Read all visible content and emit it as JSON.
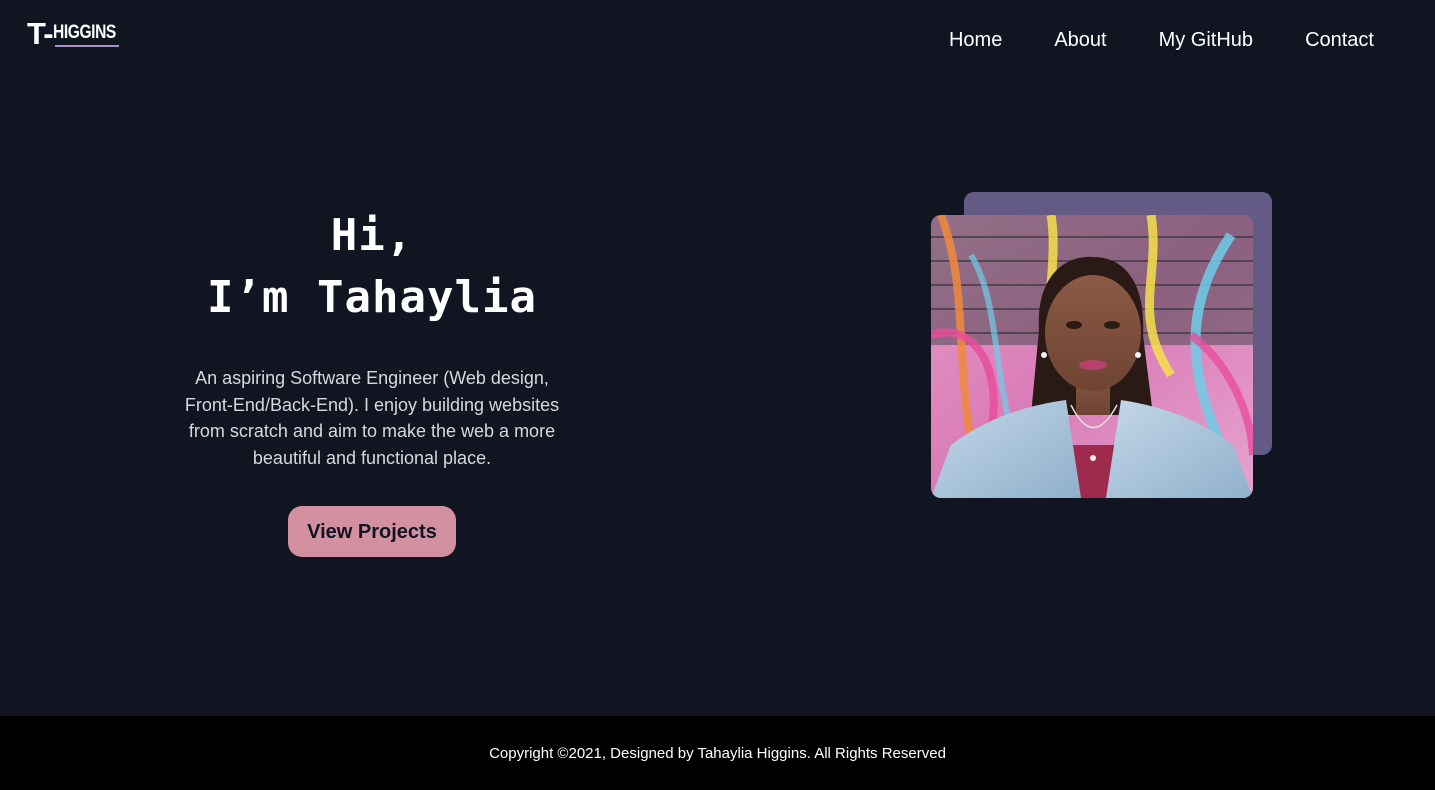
{
  "logo": {
    "t": "T-",
    "name": "HIGGINS"
  },
  "nav": {
    "items": [
      "Home",
      "About",
      "My GitHub",
      "Contact"
    ]
  },
  "hero": {
    "line1": "Hi,",
    "line2": "I’m Tahaylia",
    "description": "An aspiring Software Engineer (Web design, Front-End/Back-End). I enjoy building websites from scratch and aim to make the web a more beautiful and functional place.",
    "button": "View Projects"
  },
  "colors": {
    "background": "#111522",
    "accent_pink": "#d290a0",
    "accent_purple": "#645a86",
    "footer": "#000000"
  },
  "footer": {
    "copyright": "Copyright ©2021, Designed by Tahaylia Higgins. All Rights Reserved"
  }
}
